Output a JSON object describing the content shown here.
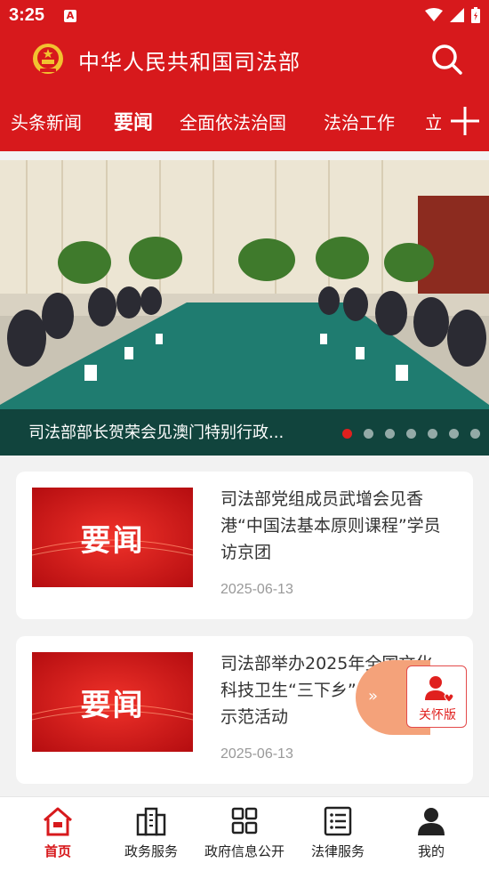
{
  "status": {
    "time": "3:25",
    "notif_letter": "A"
  },
  "header": {
    "title": "中华人民共和国司法部"
  },
  "tabs": [
    {
      "label": "头条新闻"
    },
    {
      "label": "要闻",
      "active": true
    },
    {
      "label": "全面依法治国"
    },
    {
      "label": "法治工作"
    },
    {
      "label": "立"
    }
  ],
  "banner": {
    "caption": "司法部部长贺荣会见澳门特别行政...",
    "slide_count": 7,
    "active_slide": 1
  },
  "news": [
    {
      "thumb_label": "要闻",
      "title": "司法部党组成员武增会见香港“中国法基本原则课程”学员访京团",
      "date": "2025-06-13"
    },
    {
      "thumb_label": "要闻",
      "title": "司法部举办2025年全国文化科技卫生“三下乡”（省）集中示范活动",
      "date": "2025-06-13"
    }
  ],
  "care": {
    "label": "关怀版",
    "arrow": "»"
  },
  "bottom_nav": [
    {
      "label": "首页",
      "icon": "home-icon",
      "active": true
    },
    {
      "label": "政务服务",
      "icon": "buildings-icon"
    },
    {
      "label": "政府信息公开",
      "icon": "grid-icon"
    },
    {
      "label": "法律服务",
      "icon": "list-icon"
    },
    {
      "label": "我的",
      "icon": "user-icon"
    }
  ],
  "colors": {
    "brand_red": "#d7191c",
    "care_orange": "#f4a27a"
  }
}
